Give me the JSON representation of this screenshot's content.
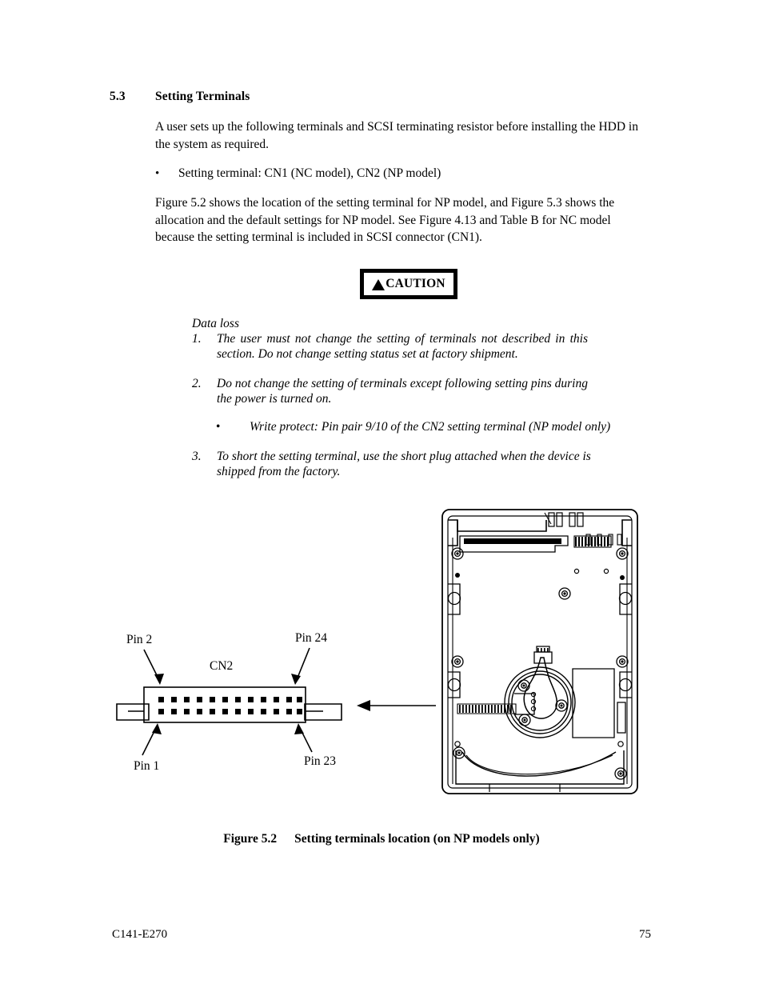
{
  "document": {
    "footer_left": "C141-E270",
    "footer_page": "75"
  },
  "section": {
    "number": "5.3",
    "title": "Setting Terminals"
  },
  "body": {
    "intro": "A user sets up the following terminals and SCSI terminating resistor before installing the HDD in the system as required.",
    "bullet_marker": "•",
    "setting_terminal_bullet": "Setting terminal:  CN1 (NC model), CN2 (NP model)",
    "figure_reference": "Figure 5.2 shows the location of the setting terminal for NP model, and Figure 5.3 shows the allocation and the default settings for NP model.  See Figure 4.13 and Table B for NC model because the setting terminal is included in SCSI connector (CN1)."
  },
  "caution": {
    "label": "CAUTION",
    "icon": "warning-triangle-icon",
    "note_title": "Data loss",
    "items": [
      {
        "marker": "1.",
        "text": "The user must not change the setting of terminals not described in this section.  Do not change setting status set at factory shipment."
      },
      {
        "marker": "2.",
        "text": "Do not change the setting of terminals except following setting pins during the power is turned on."
      },
      {
        "marker": "3.",
        "text": "To short the setting terminal, use the short plug attached when the device is shipped from the factory."
      }
    ],
    "sub_bullet_marker": "•",
    "sub_bullet": "Write protect:  Pin pair 9/10 of the CN2 setting terminal (NP model only)"
  },
  "figure": {
    "caption_number": "Figure 5.2",
    "caption_text": "Setting terminals location (on NP models only)",
    "connector": {
      "name": "CN2",
      "pin_rows": 2,
      "pins_per_row": 12,
      "total_pins": 24,
      "labels": {
        "pin2": "Pin 2",
        "pin24": "Pin 24",
        "pin1": "Pin 1",
        "pin23": "Pin 23"
      }
    }
  }
}
